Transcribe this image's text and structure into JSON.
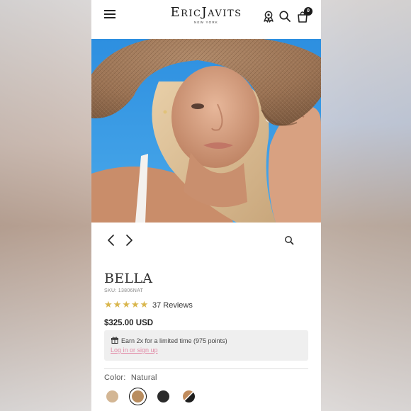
{
  "header": {
    "brand": "EricJavits",
    "brand_sub": "NEW YORK",
    "cart_count": "0",
    "icons": [
      "menu-icon",
      "rewards-icon",
      "search-icon",
      "cart-icon"
    ]
  },
  "gallery": {
    "image_alt": "Woman wearing wide-brim natural straw sun hat against blue sky",
    "prev_icon": "chevron-left-icon",
    "next_icon": "chevron-right-icon",
    "zoom_icon": "zoom-icon"
  },
  "product": {
    "name": "BELLA",
    "sku": "SKU: 13806NAT",
    "rating": 5,
    "reviews_label": "37 Reviews",
    "price": "$325.00 USD"
  },
  "rewards": {
    "earn_text": "Earn 2x for a limited time (975 points)",
    "login_text": "Log in or sign up"
  },
  "color": {
    "label": "Color:",
    "selected": "Natural",
    "swatches": [
      {
        "name": "Beige",
        "hex": "#d3b694"
      },
      {
        "name": "Natural",
        "hex": "#b98d5f"
      },
      {
        "name": "Black",
        "hex": "#2b2b2b"
      },
      {
        "name": "Black/Natural",
        "hex": "#3a3330"
      }
    ]
  },
  "colors": {
    "star": "#d9b64d",
    "link_pink": "#e28aa6",
    "panel_bg": "#efefef"
  }
}
